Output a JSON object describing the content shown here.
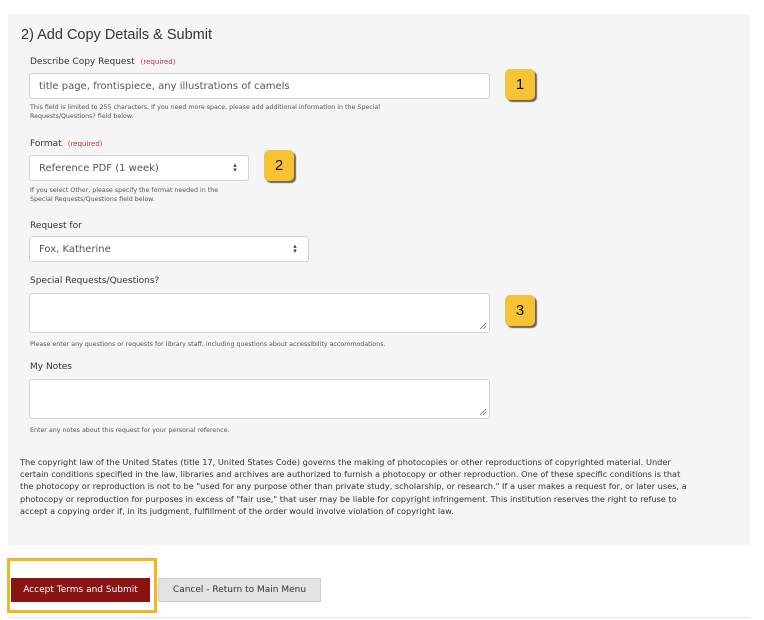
{
  "section": {
    "title": "2) Add Copy Details & Submit"
  },
  "fields": {
    "describe": {
      "label": "Describe Copy Request",
      "required": "(required)",
      "value": "title page, frontispiece, any illustrations of camels",
      "help_line1": "This field is limited to 255 characters. If you need more space, please add additional information in the Special",
      "help_line2": "Requests/Questions? field below."
    },
    "format": {
      "label": "Format",
      "required": "(required)",
      "value": "Reference PDF (1 week)",
      "help_line1": "If you select Other, please specify the format needed in the",
      "help_line2": "Special Requests/Questions field below."
    },
    "request_for": {
      "label": "Request for",
      "value": "Fox, Katherine"
    },
    "special": {
      "label": "Special Requests/Questions?",
      "value": "",
      "help": "Please enter any questions or requests for library staff, including questions about accessibility accommodations."
    },
    "notes": {
      "label": "My Notes",
      "value": "",
      "help": "Enter any notes about this request for your personal reference."
    }
  },
  "callouts": [
    "1",
    "2",
    "3"
  ],
  "legal": {
    "line1": "The copyright law of the United States (title 17, United States Code) governs the making of photocopies or other reproductions of copyrighted material. Under",
    "line2": "certain conditions specified in the law, libraries and archives are authorized to furnish a photocopy or other reproduction. One of these specific conditions is that",
    "line3": "the photocopy or reproduction is not to be \"used for any purpose other than private study, scholarship, or research.\" If a user makes a request for, or later uses, a",
    "line4": "photocopy or reproduction for purposes in excess of \"fair use,\" that user may be liable for copyright infringement. This institution reserves the right to refuse to",
    "line5": "accept a copying order if, in its judgment, fulfillment of the order would involve violation of copyright law."
  },
  "buttons": {
    "accept": "Accept Terms and Submit",
    "cancel": "Cancel - Return to Main Menu"
  },
  "colors": {
    "accent": "#8a1414",
    "callout": "#f8c332",
    "highlight": "#f0b722"
  }
}
